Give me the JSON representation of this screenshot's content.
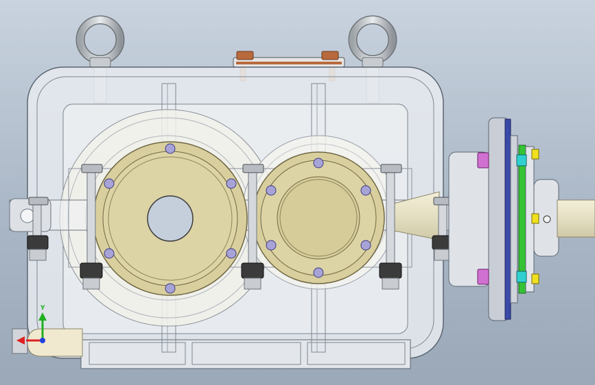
{
  "view": {
    "background_top": "#c9d3df",
    "background_bottom": "#9aa8b8"
  },
  "triad": {
    "y_label": "Y",
    "x_color": "#e02020",
    "y_color": "#20b020",
    "z_color": "#2040e0"
  },
  "colors": {
    "housing_fill": "#e7ebf0",
    "housing_line": "#5b6470",
    "gear_fill": "#f1f1ea",
    "cap_fill": "#d9cf9e",
    "cap_edge": "#6f6642",
    "bolt_fill": "#a7a3d6",
    "nut_dark": "#3b3b3b",
    "nut_light": "#b8bcc2",
    "copper": "#b86a3c",
    "flange_green": "#35c335",
    "flange_blue": "#3a4aa8",
    "bolt_yellow": "#f0e020",
    "bolt_magenta": "#d070d0",
    "bolt_cyan": "#30d0d0"
  }
}
